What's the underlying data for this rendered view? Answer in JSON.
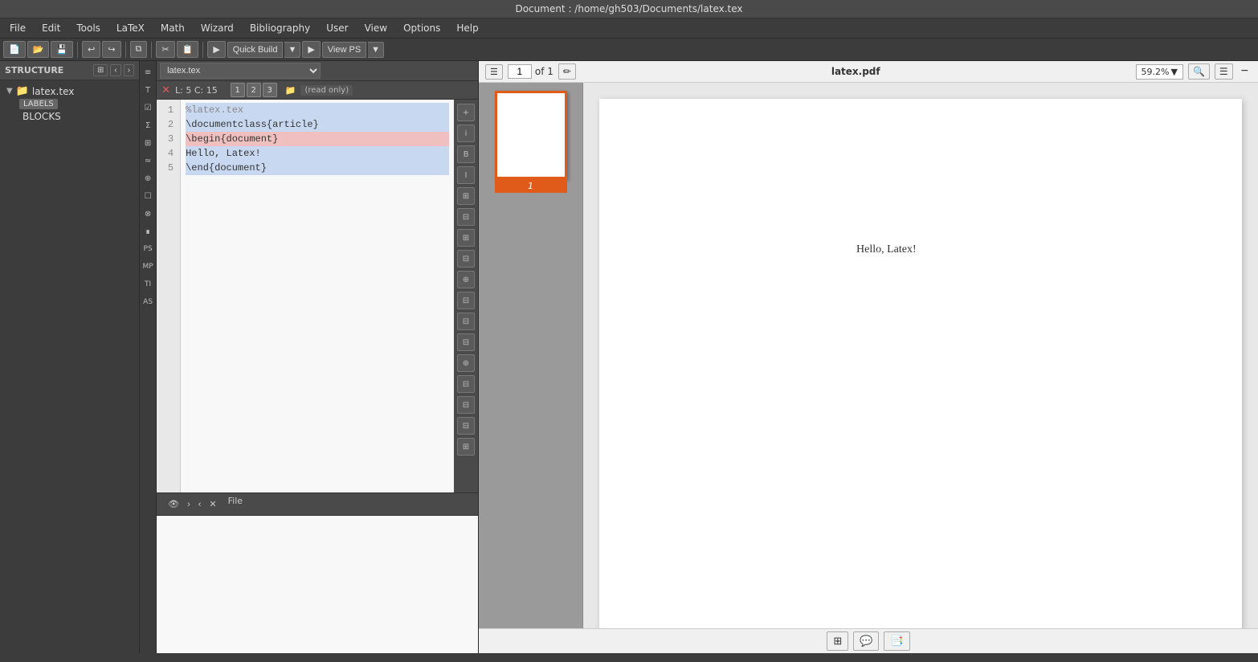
{
  "titlebar": {
    "text": "Document : /home/gh503/Documents/latex.tex"
  },
  "menubar": {
    "items": [
      "File",
      "Edit",
      "Tools",
      "LaTeX",
      "Math",
      "Wizard",
      "Bibliography",
      "User",
      "View",
      "Options",
      "Help"
    ]
  },
  "toolbar": {
    "buttons": [
      "new",
      "open",
      "save",
      "undo",
      "redo",
      "copy",
      "cut",
      "paste"
    ],
    "build_label": "Quick Build",
    "run_label": "▶",
    "view_ps_label": "View PS",
    "view_ps_dropdown": "▼"
  },
  "structure": {
    "header": "STRUCTURE",
    "file": "latex.tex",
    "labels": "LABELS",
    "blocks": "BLOCKS"
  },
  "editor_tabs": {
    "current_file": "latex.tex",
    "status": {
      "line": 5,
      "col": 15,
      "pages": [
        "1",
        "2",
        "3"
      ],
      "readonly": "(read only)"
    }
  },
  "code": {
    "lines": [
      {
        "num": 1,
        "text": "%latex.tex",
        "type": "comment"
      },
      {
        "num": 2,
        "text": "\\documentclass{article}",
        "type": "selected"
      },
      {
        "num": 3,
        "text": "\\begin{document}",
        "type": "error"
      },
      {
        "num": 4,
        "text": "Hello, Latex!",
        "type": "selected"
      },
      {
        "num": 5,
        "text": "\\end{document}",
        "type": "selected"
      }
    ]
  },
  "bottom_panel": {
    "tab": "File"
  },
  "pdf": {
    "filename": "latex.pdf",
    "page": "1",
    "of_pages": "of 1",
    "zoom": "59.2%",
    "content": "Hello, Latex!",
    "thumb_label": "1",
    "view_btns": [
      "grid",
      "comment",
      "sidebar"
    ]
  },
  "icon_sidebar": {
    "icons": [
      "≡",
      "T",
      "☑",
      "∑",
      "⊞",
      "≃",
      "⊕",
      "☐",
      "⊗",
      "∎",
      "PS",
      "MP",
      "TI",
      "AS"
    ]
  },
  "editor_right_icons": [
    "⊕",
    "⊘",
    "B",
    "I",
    "⊞",
    "⊟",
    "⊞",
    "⊟",
    "⊕",
    "⊟",
    "⊟",
    "⊟",
    "⊕",
    "⊟",
    "⊟",
    "⊟",
    "⊞"
  ]
}
